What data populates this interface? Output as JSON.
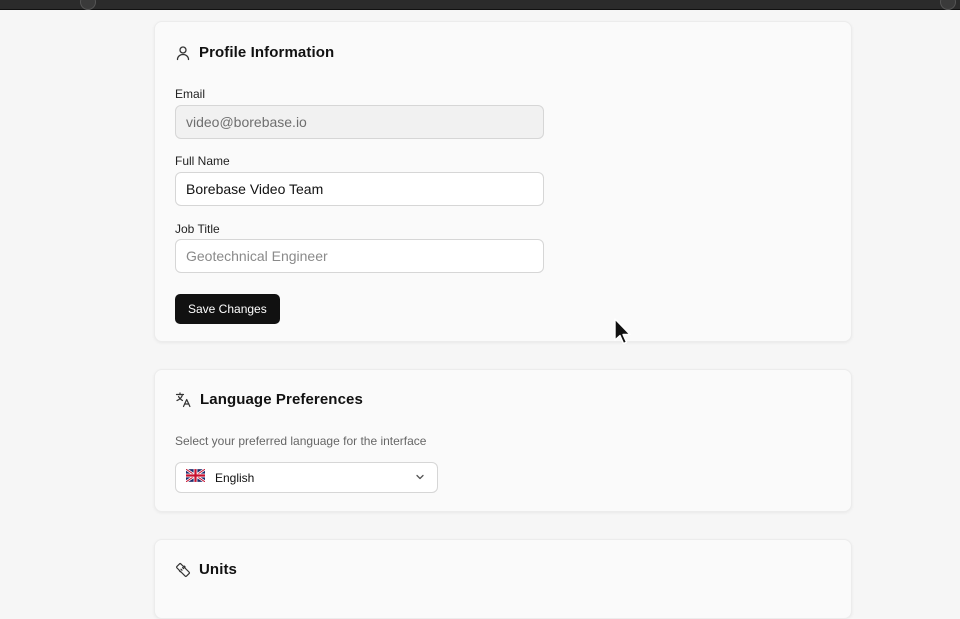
{
  "profile": {
    "title": "Profile Information",
    "email_label": "Email",
    "email_value": "video@borebase.io",
    "fullname_label": "Full Name",
    "fullname_value": "Borebase Video Team",
    "jobtitle_label": "Job Title",
    "jobtitle_placeholder": "Geotechnical Engineer",
    "save_label": "Save Changes"
  },
  "language": {
    "title": "Language Preferences",
    "description": "Select your preferred language for the interface",
    "selected": "English",
    "flag_icon": "uk-flag-icon"
  },
  "units": {
    "title": "Units"
  },
  "colors": {
    "primary_button": "#111111",
    "page_bg": "#f6f6f6",
    "card_bg": "#fafafa"
  }
}
